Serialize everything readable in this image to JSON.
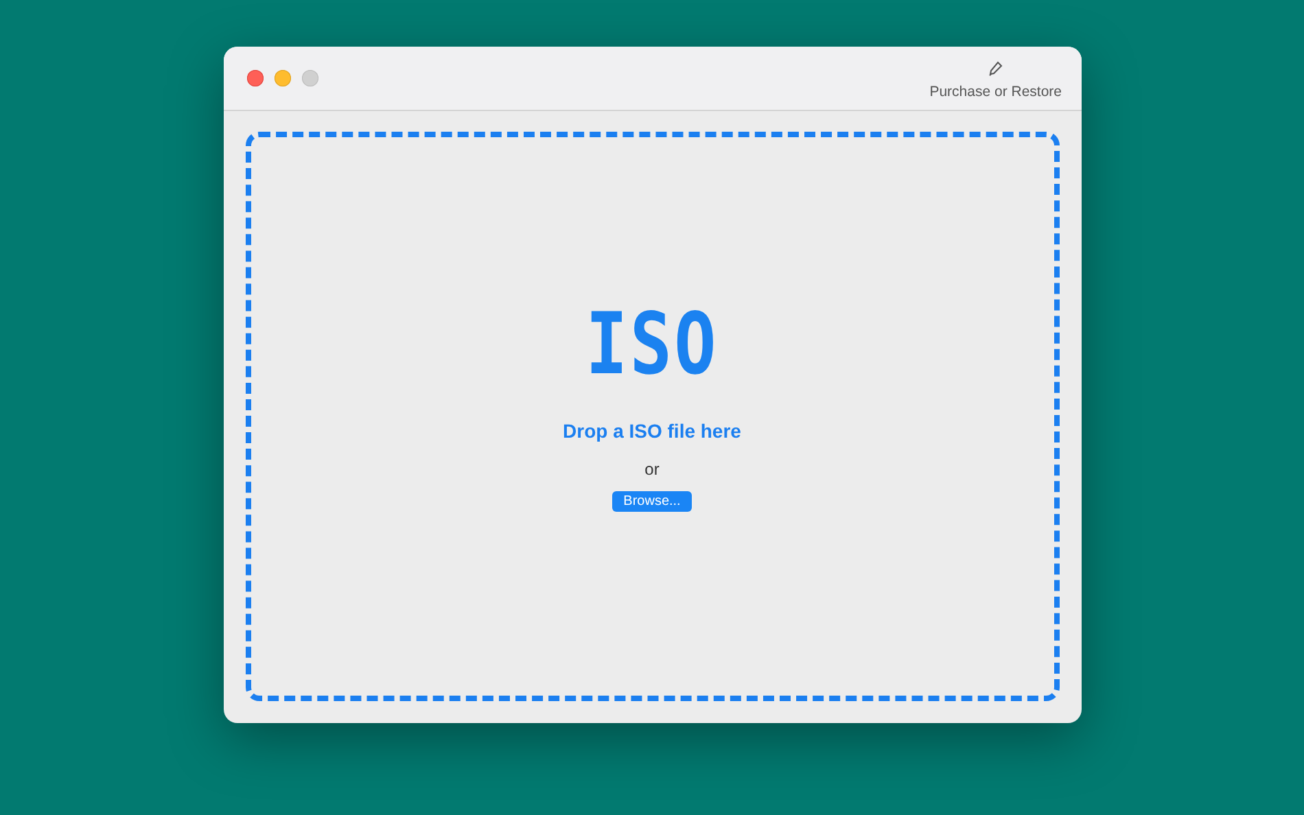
{
  "toolbar": {
    "purchase_label": "Purchase or Restore"
  },
  "drop_zone": {
    "logo": "ISO",
    "prompt": "Drop a ISO file here",
    "separator": "or",
    "browse_button": "Browse..."
  }
}
